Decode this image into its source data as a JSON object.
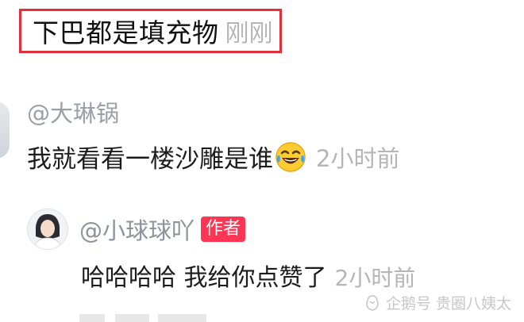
{
  "top_comment": {
    "text": "下巴都是填充物",
    "time": "刚刚",
    "highlight_color": "#e0303a"
  },
  "reply": {
    "mention": "@大琳锅",
    "text": "我就看看一楼沙雕是谁",
    "emoji_icon": "laughing-tears-emoji",
    "time": "2小时前"
  },
  "author_reply": {
    "name": "@小球球吖",
    "badge": "作者",
    "badge_color": "#ff3554",
    "text": "哈哈哈哈 我给你点赞了",
    "time": "2小时前"
  },
  "watermark": {
    "text": "企鹅号 贵圈八姨太"
  }
}
